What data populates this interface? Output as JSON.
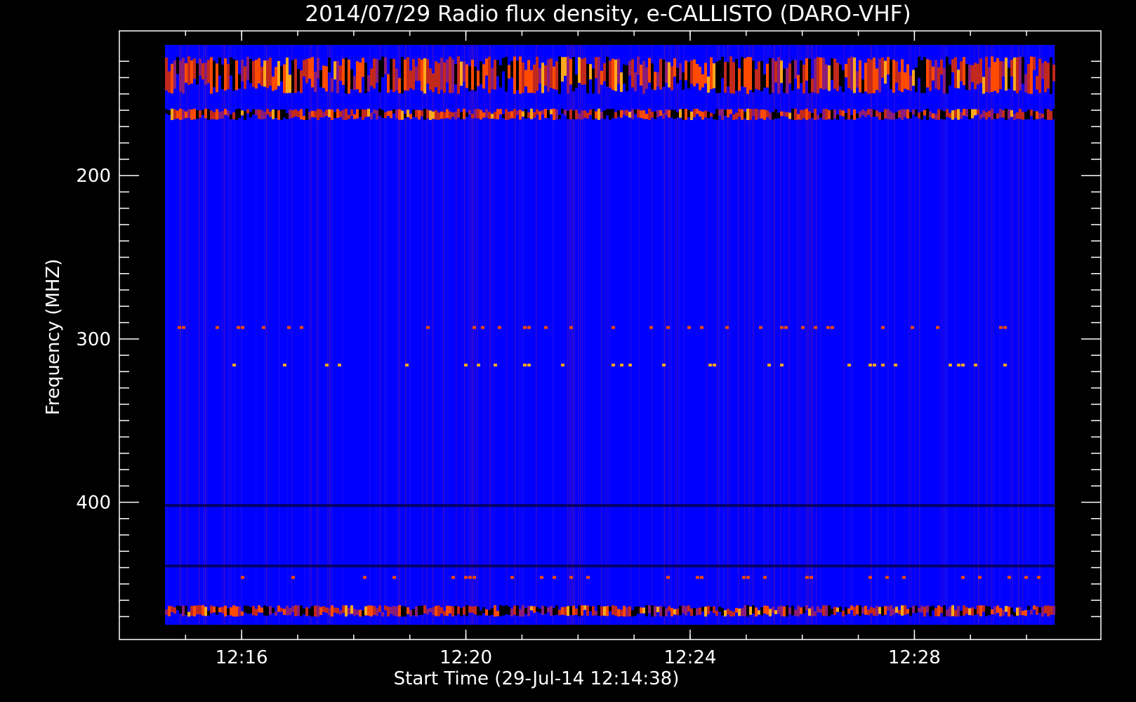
{
  "chart_data": {
    "type": "heatmap",
    "title": "2014/07/29  Radio flux density, e-CALLISTO (DARO-VHF)",
    "xlabel": "Start Time (29-Jul-14 12:14:38)",
    "ylabel": "Frequency (MHZ)",
    "x_range_minutes": [
      "12:14:38",
      "12:30:30"
    ],
    "ylim": [
      120,
      475
    ],
    "y_axis_inverted": true,
    "x_ticks": [
      {
        "label": "12:16",
        "minutes": 976
      },
      {
        "label": "12:20",
        "minutes": 980
      },
      {
        "label": "12:24",
        "minutes": 984
      },
      {
        "label": "12:28",
        "minutes": 988
      }
    ],
    "y_ticks": [
      {
        "label": "200",
        "value": 200
      },
      {
        "label": "300",
        "value": 300
      },
      {
        "label": "400",
        "value": 400
      }
    ],
    "colormap": [
      "#000000",
      "#0000ff",
      "#3a1fd6",
      "#8a1d7a",
      "#c2281c",
      "#ff4a00",
      "#ffa81c",
      "#ffffff"
    ],
    "background_level": 1,
    "features": [
      {
        "kind": "band",
        "freq_range": [
          127,
          150
        ],
        "intensity": 4,
        "description_source": "noisy high-intensity band"
      },
      {
        "kind": "band",
        "freq_range": [
          159,
          166
        ],
        "intensity": 4
      },
      {
        "kind": "band",
        "freq_range": [
          463,
          470
        ],
        "intensity": 4
      },
      {
        "kind": "line",
        "freq": 293,
        "intensity": 5
      },
      {
        "kind": "line",
        "freq": 446,
        "intensity": 5
      },
      {
        "kind": "line",
        "freq": 316,
        "intensity": 6
      },
      {
        "kind": "dark_line",
        "freq": 439,
        "intensity": 0
      },
      {
        "kind": "dark_line",
        "freq": 402,
        "intensity": 0
      }
    ]
  }
}
